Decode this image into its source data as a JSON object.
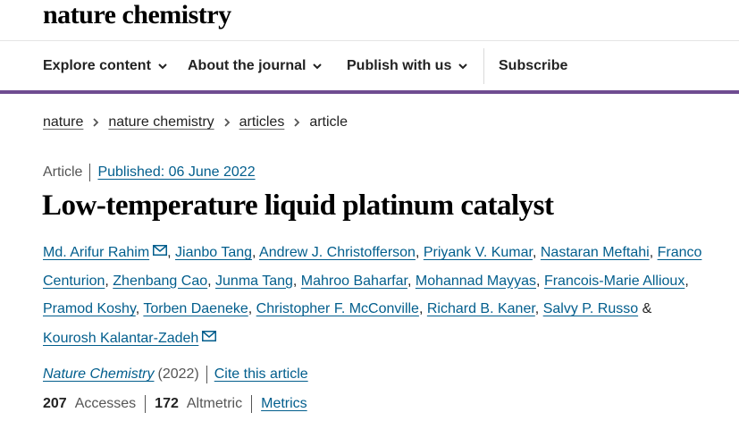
{
  "site": {
    "logo_text": "nature chemistry"
  },
  "nav": {
    "items": [
      {
        "label": "Explore content",
        "has_dropdown": true
      },
      {
        "label": "About the journal",
        "has_dropdown": true
      },
      {
        "label": "Publish with us",
        "has_dropdown": true
      }
    ],
    "subscribe_label": "Subscribe",
    "accent_color": "#6f4c91"
  },
  "breadcrumb": {
    "items": [
      "nature",
      "nature chemistry",
      "articles"
    ],
    "current": "article"
  },
  "article": {
    "type": "Article",
    "published": "Published: 06 June 2022",
    "title": "Low-temperature liquid platinum catalyst",
    "authors": [
      "Md. Arifur Rahim",
      "Jianbo Tang",
      "Andrew J. Christofferson",
      "Priyank V. Kumar",
      "Nastaran Meftahi",
      "Franco Centurion",
      "Zhenbang Cao",
      "Junma Tang",
      "Mahroo Baharfar",
      "Mohannad Mayyas",
      "Francois-Marie Allioux",
      "Pramod Koshy",
      "Torben Daeneke",
      "Christopher F. McConville",
      "Richard B. Kaner",
      "Salvy P. Russo",
      "Kourosh Kalantar-Zadeh"
    ],
    "and_text": "&",
    "journal": "Nature Chemistry",
    "year": "(2022)",
    "cite_label": "Cite this article",
    "accesses_count": "207",
    "accesses_label": "Accesses",
    "altmetric_count": "172",
    "altmetric_label": "Altmetric",
    "metrics_label": "Metrics",
    "link_color": "#025e8d"
  }
}
